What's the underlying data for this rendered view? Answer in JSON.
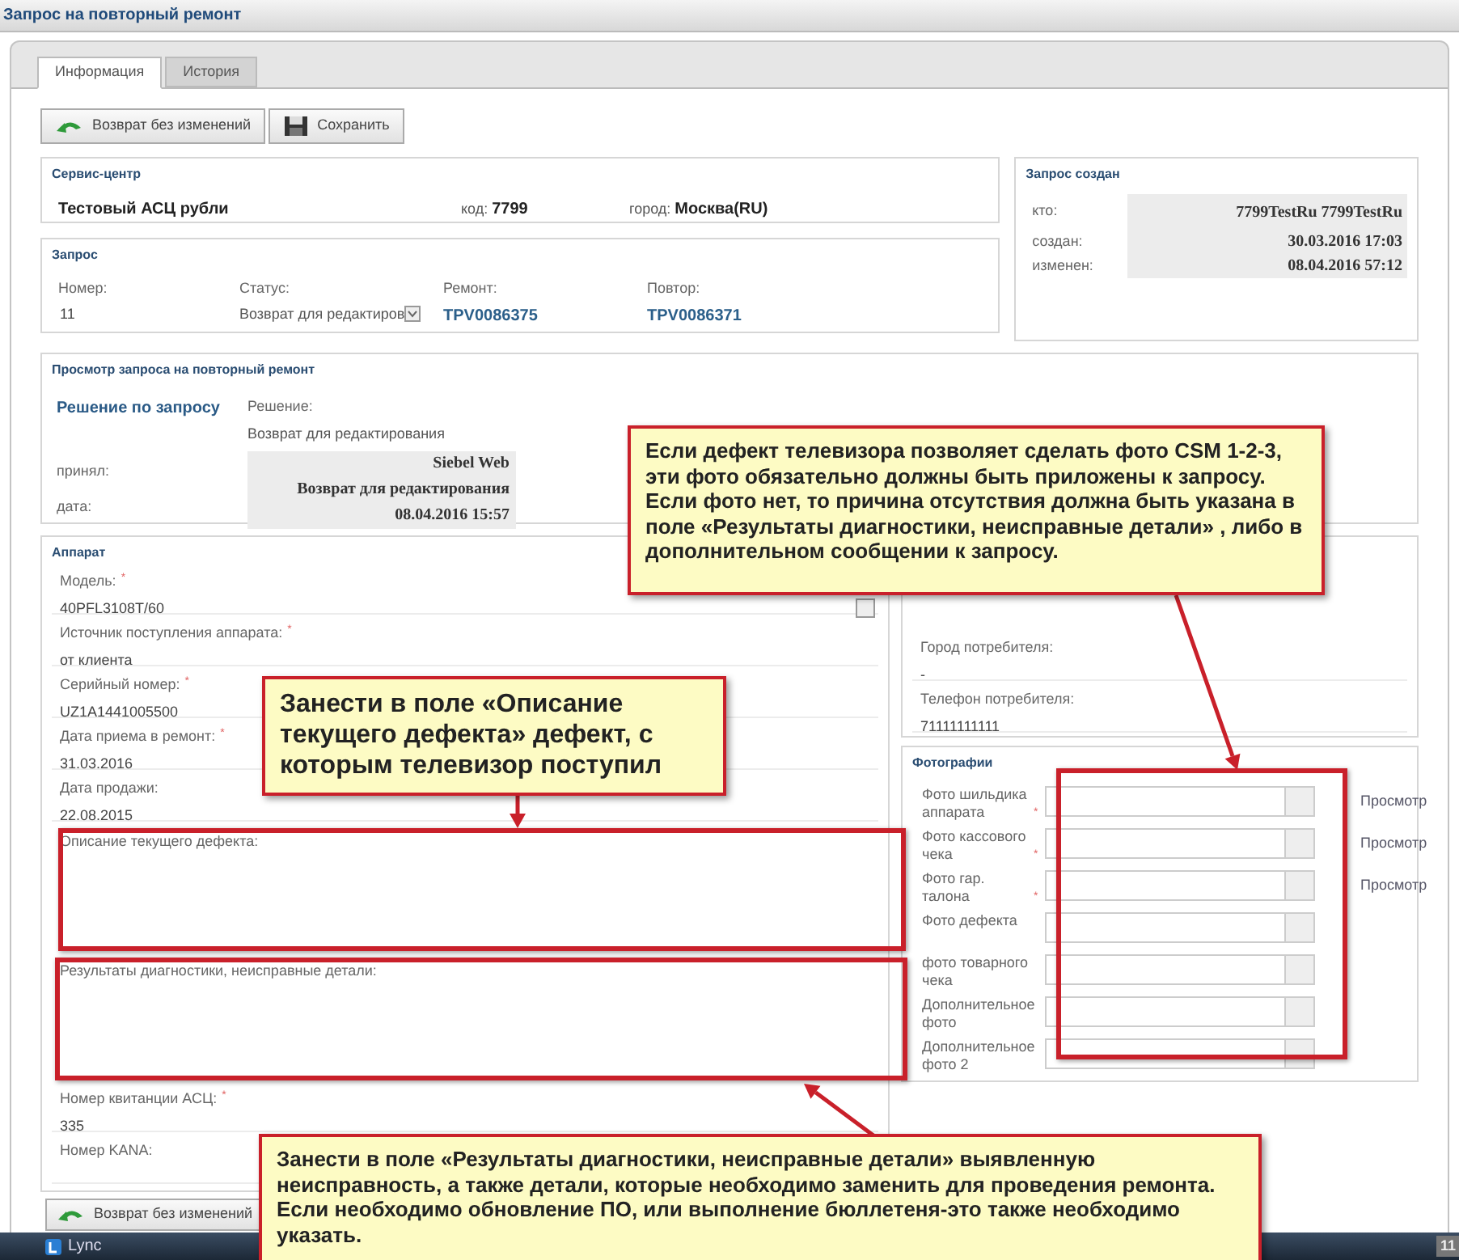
{
  "window": {
    "title": "Запрос на повторный ремонт"
  },
  "tabs": [
    {
      "label": "Информация",
      "selected": true
    },
    {
      "label": "История",
      "selected": false
    }
  ],
  "toolbar": [
    {
      "label": "Возврат без изменений",
      "kind": "back"
    },
    {
      "label": "Сохранить",
      "kind": "save"
    }
  ],
  "service_center": {
    "title": "Сервис-центр",
    "name": "Тестовый АСЦ рубли",
    "code_label": "код:",
    "code": "7799",
    "city_label": "город:",
    "city": "Москва(RU)"
  },
  "request": {
    "title": "Запрос",
    "fields": [
      {
        "label": "Номер:",
        "value": "11",
        "kind": "text"
      },
      {
        "label": "Статус:",
        "value": "Возврат для редактиров",
        "kind": "select"
      },
      {
        "label": "Ремонт:",
        "value": "TPV0086375",
        "kind": "link"
      },
      {
        "label": "Повтор:",
        "value": "TPV0086371",
        "kind": "link"
      }
    ]
  },
  "created": {
    "title": "Запрос создан",
    "rows": [
      {
        "label": "кто:",
        "value": "7799TestRu 7799TestRu"
      },
      {
        "label": "создан:",
        "value": "30.03.2016 17:03"
      },
      {
        "label": "изменен:",
        "value": "08.04.2016 57:12"
      }
    ]
  },
  "review": {
    "title": "Просмотр запроса на повторный ремонт",
    "heading": "Решение по запросу",
    "decision_label": "Решение:",
    "decision": "Возврат для редактирования",
    "accepted_label": "принял:",
    "accepted_by": "Siebel Web",
    "accepted_status": "Возврат для редактирования",
    "date_label": "дата:",
    "date": "08.04.2016 15:57"
  },
  "required_mark": "*",
  "device": {
    "title": "Аппарат",
    "fields": [
      {
        "label": "Модель:",
        "required": true,
        "value": "40PFL3108T/60"
      },
      {
        "label": "Источник поступления аппарата:",
        "required": true,
        "value": "от клиента"
      },
      {
        "label": "Серийный номер:",
        "required": true,
        "value": "UZ1A1441005500"
      },
      {
        "label": "Дата приема в ремонт:",
        "required": true,
        "value": "31.03.2016"
      },
      {
        "label": "Дата продажи:",
        "required": false,
        "value": "22.08.2015"
      }
    ],
    "defect_label": "Описание текущего дефекта:",
    "diagnostics_label": "Результаты диагностики, неисправные детали:",
    "more_fields": [
      {
        "label": "Номер квитанции АСЦ:",
        "required": true,
        "value": "335"
      },
      {
        "label": "Номер KANA:",
        "required": false
      }
    ]
  },
  "customer": {
    "fields": [
      {
        "label": "Город потребителя:",
        "value": "-"
      },
      {
        "label": "Телефон потребителя:",
        "value": "71111111111"
      }
    ]
  },
  "photos": {
    "title": "Фотографии",
    "rows": [
      {
        "label": "Фото шильдика аппарата",
        "required": true,
        "view": "Просмотр"
      },
      {
        "label": "Фото кассового чека",
        "required": true,
        "view": "Просмотр"
      },
      {
        "label": "Фото гар. талона",
        "required": true,
        "view": "Просмотр"
      },
      {
        "label": "Фото дефекта",
        "required": false
      },
      {
        "label": "фото товарного чека",
        "required": false
      },
      {
        "label": "Дополнительное фото",
        "required": false
      },
      {
        "label": "Дополнительное фото 2",
        "required": false
      }
    ]
  },
  "bottom_button": {
    "label": "Возврат без изменений"
  },
  "taskbar": {
    "items": [
      {
        "label": "Lync"
      }
    ],
    "page_number": "11"
  },
  "callouts": [
    "Если дефект телевизора позволяет сделать фото CSM 1-2-3, эти фото обязательно должны быть приложены к запросу. Если фото нет, то причина отсутствия должна быть указана в поле «Результаты диагностики, неисправные детали» , либо в дополнительном сообщении к запросу.",
    "Занести в поле «Описание текущего дефекта» дефект, с которым телевизор поступил",
    "Занести в поле «Результаты диагностики, неисправные детали» выявленную неисправность, а также детали, которые необходимо заменить для проведения ремонта. Если необходимо обновление ПО, или выполнение бюллетеня-это также необходимо указать."
  ]
}
